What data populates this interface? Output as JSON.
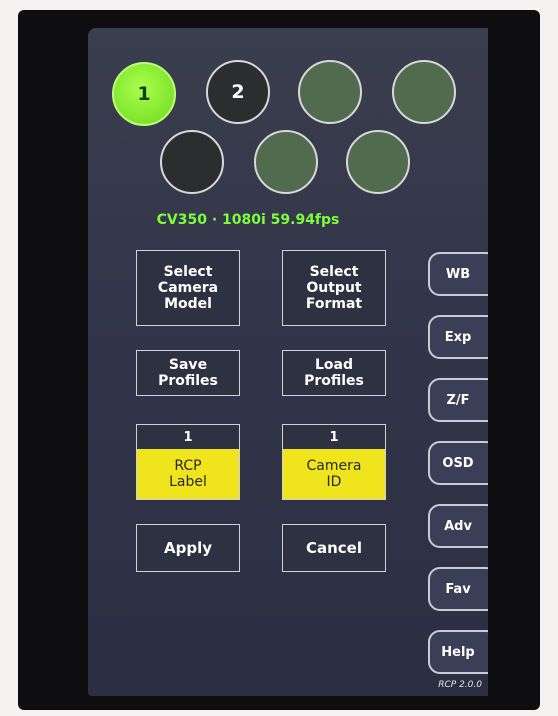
{
  "camera_selector": {
    "buttons": [
      {
        "label": "1",
        "state": "active"
      },
      {
        "label": "2",
        "state": "dark"
      },
      {
        "label": "",
        "state": "green"
      },
      {
        "label": "",
        "state": "green"
      },
      {
        "label": "",
        "state": "dark"
      },
      {
        "label": "",
        "state": "green"
      },
      {
        "label": "",
        "state": "green"
      }
    ]
  },
  "status": {
    "text": "CV350 · 1080i 59.94fps",
    "color": "#7cff3b"
  },
  "actions": {
    "select_camera_model": "Select\nCamera\nModel",
    "select_output_format": "Select\nOutput\nFormat",
    "save_profiles": "Save\nProfiles",
    "load_profiles": "Load\nProfiles",
    "apply": "Apply",
    "cancel": "Cancel"
  },
  "rcp_label": {
    "value": "1",
    "label": "RCP\nLabel"
  },
  "camera_id": {
    "value": "1",
    "label": "Camera\nID"
  },
  "side_tabs": [
    "WB",
    "Exp",
    "Z/F",
    "OSD",
    "Adv",
    "Fav",
    "Help"
  ],
  "version": "RCP 2.0.0",
  "colors": {
    "highlight_yellow": "#f0e41c",
    "active_green": "#8cf036"
  }
}
